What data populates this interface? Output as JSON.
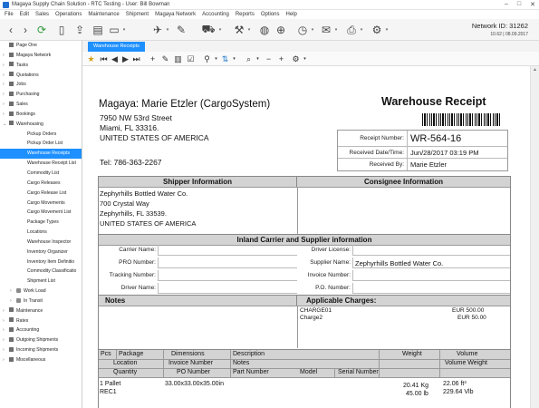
{
  "window": {
    "title": "Magaya Supply Chain Solution - RTC Testing - User: Bill Bowman"
  },
  "menu": [
    "File",
    "Edit",
    "Sales",
    "Operations",
    "Maintenance",
    "Shipment",
    "Magaya Network",
    "Accounting",
    "Reports",
    "Options",
    "Help"
  ],
  "network": {
    "label": "Network ID:",
    "id": "31262",
    "version": "10.62 | 08.09.2017"
  },
  "toolbar_icons": [
    "back-icon",
    "forward-icon",
    "refresh-icon",
    "new-document-icon",
    "export-icon",
    "document-icon",
    "air-icon",
    "edit-icon",
    "truck-icon",
    "globe-icon",
    "network-icon",
    "clock-icon",
    "mail-icon",
    "print-icon",
    "settings-icon"
  ],
  "sidebar": {
    "items": [
      {
        "label": "Page One",
        "level": 0,
        "chev": ""
      },
      {
        "label": "Magaya Network",
        "level": 0,
        "chev": "›"
      },
      {
        "label": "Tasks",
        "level": 0,
        "chev": "›"
      },
      {
        "label": "Quotations",
        "level": 0,
        "chev": "›"
      },
      {
        "label": "Jobs",
        "level": 0,
        "chev": "›"
      },
      {
        "label": "Purchasing",
        "level": 0,
        "chev": "›"
      },
      {
        "label": "Sales",
        "level": 0,
        "chev": "›"
      },
      {
        "label": "Bookings",
        "level": 0,
        "chev": "›"
      },
      {
        "label": "Warehousing",
        "level": 0,
        "chev": "⌄"
      },
      {
        "label": "Pickup Orders",
        "level": 1,
        "chev": ""
      },
      {
        "label": "Pickup Order List",
        "level": 1,
        "chev": ""
      },
      {
        "label": "Warehouse Receipts",
        "level": 1,
        "chev": "",
        "selected": true
      },
      {
        "label": "Warehouse Receipt List",
        "level": 1,
        "chev": ""
      },
      {
        "label": "Commodity List",
        "level": 1,
        "chev": ""
      },
      {
        "label": "Cargo Releases",
        "level": 1,
        "chev": ""
      },
      {
        "label": "Cargo Release List",
        "level": 1,
        "chev": ""
      },
      {
        "label": "Cargo Movements",
        "level": 1,
        "chev": ""
      },
      {
        "label": "Cargo Movement List",
        "level": 1,
        "chev": ""
      },
      {
        "label": "Package Types",
        "level": 1,
        "chev": ""
      },
      {
        "label": "Locations",
        "level": 1,
        "chev": ""
      },
      {
        "label": "Warehouse Inspector",
        "level": 1,
        "chev": ""
      },
      {
        "label": "Inventory Organizer",
        "level": 1,
        "chev": ""
      },
      {
        "label": "Inventory Item Definitio",
        "level": 1,
        "chev": ""
      },
      {
        "label": "Commodity Classificatio",
        "level": 1,
        "chev": ""
      },
      {
        "label": "Shipment List",
        "level": 1,
        "chev": ""
      },
      {
        "label": "Work Load",
        "level": 1,
        "chev": "›",
        "folder": true
      },
      {
        "label": "In Transit",
        "level": 1,
        "chev": "›",
        "folder": true
      },
      {
        "label": "Maintenance",
        "level": 0,
        "chev": "›"
      },
      {
        "label": "Rates",
        "level": 0,
        "chev": "›"
      },
      {
        "label": "Accounting",
        "level": 0,
        "chev": "›"
      },
      {
        "label": "Outgoing Shipments",
        "level": 0,
        "chev": "›"
      },
      {
        "label": "Incoming Shipments",
        "level": 0,
        "chev": "›"
      },
      {
        "label": "Miscellaneous",
        "level": 0,
        "chev": "›"
      }
    ]
  },
  "tab": {
    "label": "Warehouse Receipts"
  },
  "document": {
    "company": "Magaya: Marie Etzler (CargoSystem)",
    "title": "Warehouse Receipt",
    "address": [
      "7950 NW 53rd Street",
      "Miami, FL 33316.",
      "UNITED STATES OF AMERICA"
    ],
    "tel": "Tel: 786-363-2267",
    "info": [
      {
        "label": "Receipt Number:",
        "value": "WR-564-16",
        "big": true
      },
      {
        "label": "Received Date/Time:",
        "value": "Jun/28/2017   03:19 PM"
      },
      {
        "label": "Received By:",
        "value": "Marie Etzler"
      }
    ],
    "shipper_header": "Shipper Information",
    "consignee_header": "Consignee Information",
    "shipper": [
      "Zephyrhills Bottled Water Co.",
      "700 Crystal Way",
      "Zephyrhills, FL 33539.",
      "UNITED STATES OF AMERICA"
    ],
    "inland_header": "Inland Carrier and Supplier information",
    "left_fields": [
      "Carrier Name:",
      "PRO Number:",
      "Tracking Number:",
      "Driver Name:"
    ],
    "right_fields": [
      "Driver License:",
      "Supplier Name:",
      "Invoice Number:",
      "P.O. Number:"
    ],
    "supplier_name": "Zephyrhills Bottled Water Co.",
    "notes_header": "Notes",
    "charges_header": "Applicable Charges:",
    "charges": [
      {
        "name": "CHARGE01",
        "amount": "EUR 500.00"
      },
      {
        "name": "Charge2",
        "amount": "EUR 50.00"
      }
    ],
    "cols_row1": [
      "Pcs",
      "Package",
      "Dimensions",
      "Description",
      "Weight",
      "Volume"
    ],
    "cols_row2": [
      "Location",
      "Invoice Number",
      "Notes",
      "Volume Weight"
    ],
    "cols_row3": [
      "Quantity",
      "PO Number",
      "Part Number",
      "Model",
      "Serial Number"
    ],
    "item": {
      "pcs": "1 Pallet",
      "dims": "33.00x33.00x35.00in",
      "location": "REC1",
      "weight": "20.41 Kg",
      "weight2": "45.00 lb",
      "volume": "22.06 ft³",
      "volume2": "229.64 Vlb"
    }
  }
}
